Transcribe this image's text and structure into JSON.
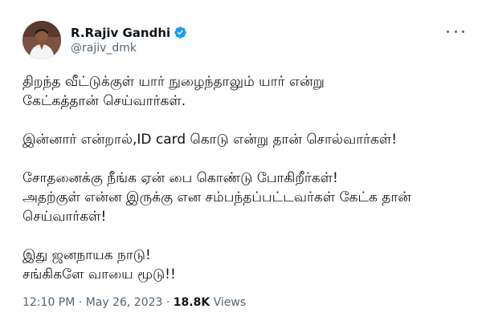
{
  "author": {
    "name": "R.Rajiv Gandhi",
    "handle": "@rajiv_dmk",
    "verified": true
  },
  "icons": {
    "verified": "verified-badge-icon",
    "more": "more-options-icon"
  },
  "colors": {
    "verified_blue": "#1d9bf0",
    "text_primary": "#0f1419",
    "text_secondary": "#536471"
  },
  "tweet": {
    "paragraphs": [
      [
        "திறந்த வீட்டுக்குள் யார் நுழைந்தாலும் யார் என்று",
        "கேட்கத்தான் செய்வார்கள்."
      ],
      [
        "இன்னார் என்றால்,ID card கொடு என்று தான் சொல்வார்கள்!"
      ],
      [
        "சோதனைக்கு நீங்க ஏன் பை கொண்டு போகிறீர்கள்!",
        "அதற்குள் என்ன இருக்கு என சம்பந்தப்பட்டவர்கள் கேட்க தான்",
        "செய்வார்கள்!"
      ],
      [
        "இது ஜனநாயக நாடு!",
        "சங்கிகளே வாயை மூடு!!"
      ]
    ]
  },
  "meta": {
    "time": "12:10 PM",
    "separator": "·",
    "date": "May 26, 2023",
    "views_count": "18.8K",
    "views_label": "Views"
  }
}
